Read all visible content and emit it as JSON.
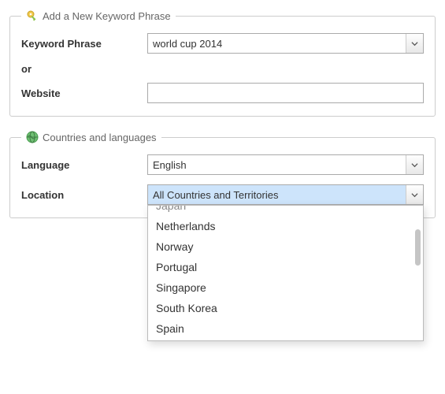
{
  "keyword_section": {
    "legend": "Add a New Keyword Phrase",
    "keyword_label": "Keyword Phrase",
    "keyword_value": "world cup 2014",
    "or_label": "or",
    "website_label": "Website",
    "website_value": ""
  },
  "countries_section": {
    "legend": "Countries and languages",
    "language_label": "Language",
    "language_value": "English",
    "location_label": "Location",
    "location_value": "All Countries and Territories",
    "location_options": [
      "Japan",
      "Netherlands",
      "Norway",
      "Portugal",
      "Singapore",
      "South Korea",
      "Spain"
    ]
  }
}
